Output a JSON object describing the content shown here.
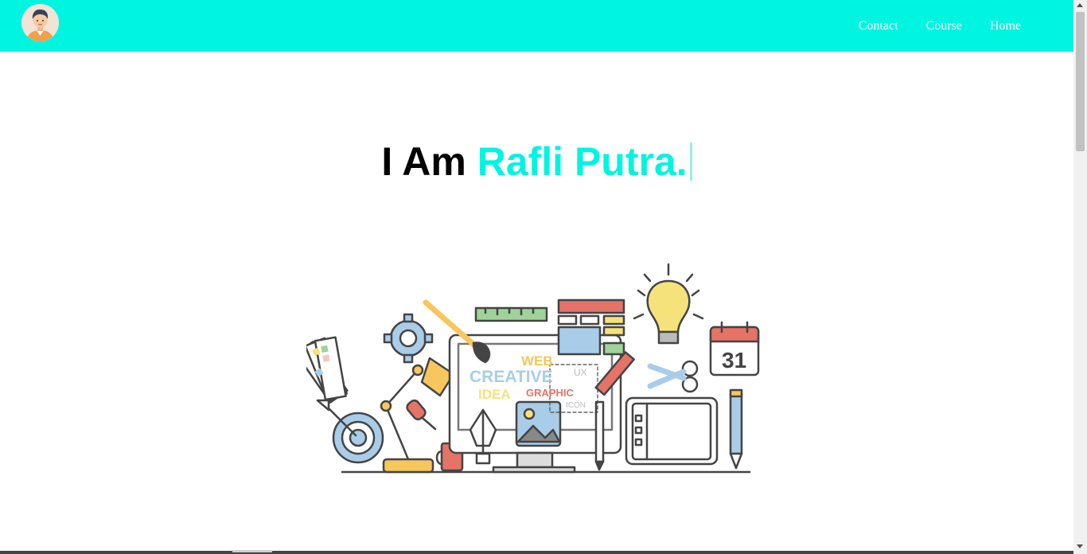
{
  "nav": {
    "logo": {
      "icon": "avatar-icon"
    },
    "links": [
      {
        "label": "Contact"
      },
      {
        "label": "Course"
      },
      {
        "label": "Home"
      }
    ]
  },
  "hero": {
    "prefix": "I Am",
    "name": "Rafli Putra."
  },
  "illustration": {
    "words": [
      "WEB",
      "CREATIVE",
      "IDEA",
      "GRAPHIC",
      "UX",
      "ICON"
    ],
    "calendar_day": "31"
  },
  "colors": {
    "accent": "#00f5e1",
    "text": "#000000"
  }
}
